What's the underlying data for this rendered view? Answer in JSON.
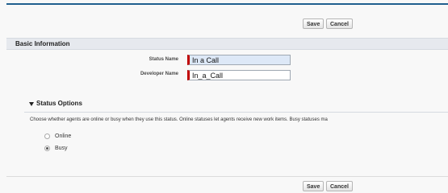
{
  "toolbar_top": {
    "save_label": "Save",
    "cancel_label": "Cancel"
  },
  "basic_information": {
    "title": "Basic Information",
    "status_name": {
      "label": "Status Name",
      "value": "In a Call"
    },
    "developer_name": {
      "label": "Developer Name",
      "value": "In_a_Call"
    }
  },
  "status_options": {
    "title": "Status Options",
    "description": "Choose whether agents are online or busy when they use this status. Online statuses let agents receive new work items. Busy statuses ma",
    "options": [
      {
        "label": "Online",
        "checked": false
      },
      {
        "label": "Busy",
        "checked": true
      }
    ]
  },
  "toolbar_bottom": {
    "save_label": "Save",
    "cancel_label": "Cancel"
  },
  "colors": {
    "top_rule": "#1f5f8e",
    "required_marker": "#c00000",
    "highlight_input": "#dde8f7",
    "section_header_bg": "#e6e9ee"
  }
}
